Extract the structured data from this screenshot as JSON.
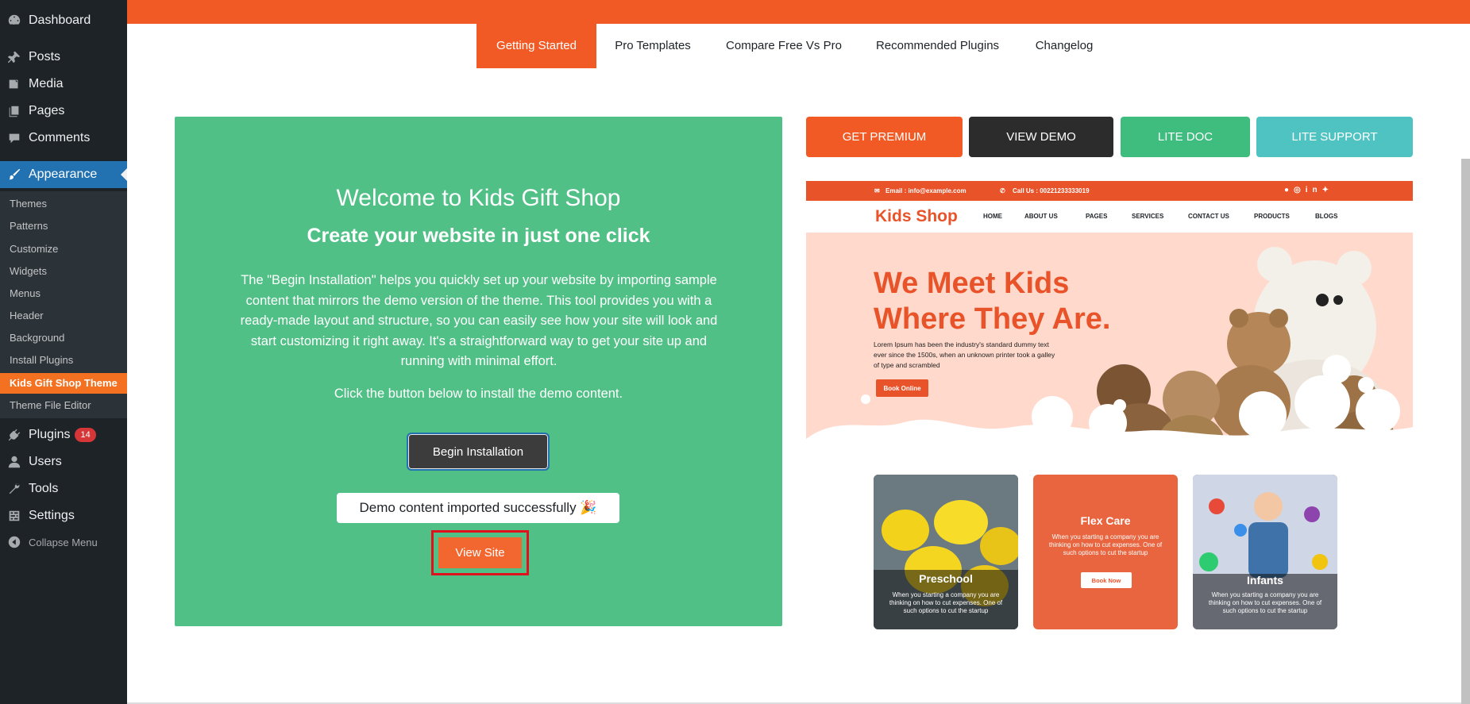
{
  "sidebar": {
    "dashboard": "Dashboard",
    "posts": "Posts",
    "media": "Media",
    "pages": "Pages",
    "comments": "Comments",
    "appearance": "Appearance",
    "submenu": [
      "Themes",
      "Patterns",
      "Customize",
      "Widgets",
      "Menus",
      "Header",
      "Background",
      "Install Plugins",
      "Kids Gift Shop Theme",
      "Theme File Editor"
    ],
    "plugins": "Plugins",
    "plugins_badge": "14",
    "users": "Users",
    "tools": "Tools",
    "settings": "Settings",
    "collapse": "Collapse Menu"
  },
  "tabs": [
    "Getting Started",
    "Pro Templates",
    "Compare Free Vs Pro",
    "Recommended Plugins",
    "Changelog"
  ],
  "panel": {
    "welcome": "Welcome to Kids Gift Shop",
    "headline": "Create your website in just one click",
    "description": "The \"Begin Installation\" helps you quickly set up your website by importing sample content that mirrors the demo version of the theme. This tool provides you with a ready-made layout and structure, so you can easily see how your site will look and start customizing it right away. It's a straightforward way to get your site up and running with minimal effort.",
    "click_text": "Click the button below to install the demo content.",
    "begin_button": "Begin Installation",
    "success_message": "Demo content imported successfully 🎉",
    "view_site_button": "View Site"
  },
  "actions": {
    "get_premium": "GET PREMIUM",
    "view_demo": "VIEW DEMO",
    "lite_doc": "LITE DOC",
    "lite_support": "LITE SUPPORT"
  },
  "preview": {
    "email": "Email : info@example.com",
    "call": "Call Us : 00221233333019",
    "logo": "Kids Shop",
    "nav": [
      "HOME",
      "ABOUT US",
      "PAGES",
      "SERVICES",
      "CONTACT US",
      "PRODUCTS",
      "BLOGS"
    ],
    "hero_title": "We Meet Kids Where They Are.",
    "hero_text": "Lorem Ipsum has been the industry's standard dummy text ever since the 1500s, when an unknown printer took a galley of type and scrambled",
    "hero_button": "Book Online",
    "cards": [
      {
        "title": "Preschool",
        "text": "When you starting a company you are thinking on how to cut expenses. One of such options to cut the startup"
      },
      {
        "title": "Flex Care",
        "text": "When you starting a company you are thinking on how to cut expenses. One of such options to cut the startup",
        "button": "Book Now"
      },
      {
        "title": "Infants",
        "text": "When you starting a company you are thinking on how to cut expenses. One of such options to cut the startup"
      }
    ]
  },
  "colors": {
    "brand_orange": "#f15a24",
    "panel_green": "#50c086",
    "wp_blue": "#2271b1",
    "dark": "#1d2327"
  }
}
